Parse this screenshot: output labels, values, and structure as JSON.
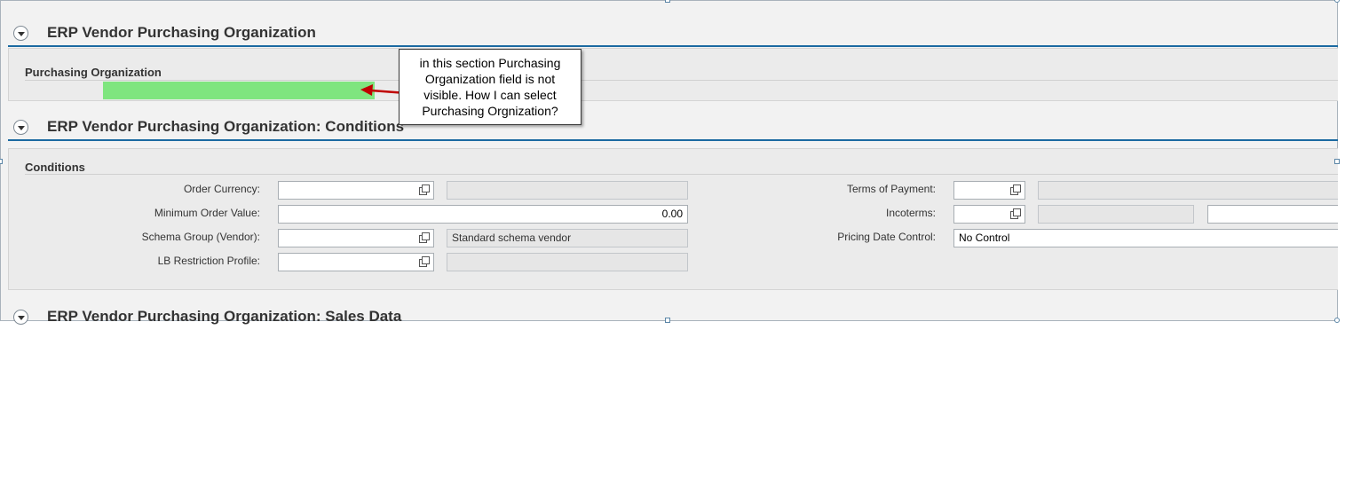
{
  "sections": {
    "vendor_porg": {
      "title": "ERP Vendor Purchasing Organization"
    },
    "conditions": {
      "title": "ERP Vendor Purchasing Organization: Conditions"
    },
    "sales_data": {
      "title": "ERP Vendor Purchasing Organization: Sales Data"
    }
  },
  "porg_panel": {
    "title": "Purchasing Organization",
    "highlight_color": "#7fe57f"
  },
  "callout": {
    "text": "in this section Purchasing Organization field is not visible.  How I can select Purchasing Orgnization?",
    "arrow_color": "#c00000"
  },
  "conditions_panel": {
    "title": "Conditions",
    "order_currency": {
      "label": "Order Currency:",
      "value": "",
      "description": ""
    },
    "min_order_value": {
      "label": "Minimum Order Value:",
      "value": "0.00"
    },
    "schema_group": {
      "label": "Schema Group (Vendor):",
      "value": "",
      "description": "Standard schema vendor"
    },
    "lb_restriction": {
      "label": "LB Restriction Profile:",
      "value": "",
      "description": ""
    },
    "terms_of_payment": {
      "label": "Terms of Payment:",
      "value": "",
      "description": ""
    },
    "incoterms": {
      "label": "Incoterms:",
      "value": "",
      "description": "",
      "location": ""
    },
    "pricing_date_control": {
      "label": "Pricing Date Control:",
      "value": "No Control"
    }
  },
  "colors": {
    "section_rule": "#1b6aa1",
    "background": "#f2f2f2"
  },
  "icons": {
    "toggle": "collapse-toggle-icon",
    "value_help": "value-help-icon"
  }
}
